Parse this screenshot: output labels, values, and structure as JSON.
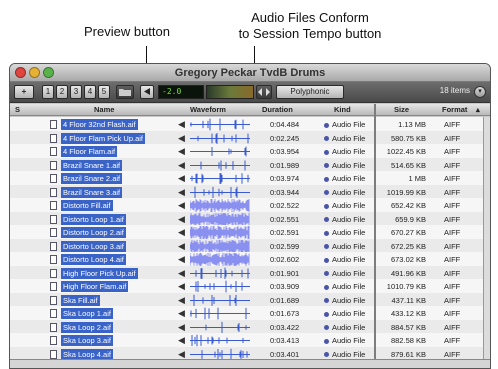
{
  "callouts": {
    "preview": "Preview button",
    "conform_line1": "Audio Files Conform",
    "conform_line2": "to Session Tempo button"
  },
  "window": {
    "title": "Gregory Peckar TvdB Drums"
  },
  "toolbar": {
    "add_label": "+",
    "nums": [
      "1",
      "2",
      "3",
      "4",
      "5"
    ],
    "folder_icon": "folder-icon",
    "preview_icon": "play-triangle-icon",
    "level_value": "-2.0",
    "conform_icon": "conform-tempo-icon",
    "polyphonic_label": "Polyphonic",
    "item_count": "18 items",
    "options_icon": "options-circle-icon"
  },
  "columns": {
    "s": "S",
    "name": "Name",
    "waveform": "Waveform",
    "duration": "Duration",
    "kind": "Kind",
    "size": "Size",
    "format": "Format"
  },
  "colors": {
    "selection": "#3a63c8",
    "waveform_simple": "#3a5bd0",
    "waveform_dense": "#8a90f0",
    "kind_dot": "#4a55a8"
  },
  "rows": [
    {
      "name": "4 Floor 32nd Flash.aif",
      "duration": "0:04.484",
      "kind": "Audio File",
      "size": "1.13 MB",
      "format": "AIFF",
      "dense": false
    },
    {
      "name": "4 Floor Flam Pick Up.aif",
      "duration": "0:02.245",
      "kind": "Audio File",
      "size": "580.75 KB",
      "format": "AIFF",
      "dense": false
    },
    {
      "name": "4 Floor Flam.aif",
      "duration": "0:03.954",
      "kind": "Audio File",
      "size": "1022.45 KB",
      "format": "AIFF",
      "dense": false
    },
    {
      "name": "Brazil Snare 1.aif",
      "duration": "0:01.989",
      "kind": "Audio File",
      "size": "514.65 KB",
      "format": "AIFF",
      "dense": false
    },
    {
      "name": "Brazil Snare 2.aif",
      "duration": "0:03.974",
      "kind": "Audio File",
      "size": "1 MB",
      "format": "AIFF",
      "dense": false
    },
    {
      "name": "Brazil Snare 3.aif",
      "duration": "0:03.944",
      "kind": "Audio File",
      "size": "1019.99 KB",
      "format": "AIFF",
      "dense": false
    },
    {
      "name": "Distorto Fill.aif",
      "duration": "0:02.522",
      "kind": "Audio File",
      "size": "652.42 KB",
      "format": "AIFF",
      "dense": true
    },
    {
      "name": "Distorto Loop 1.aif",
      "duration": "0:02.551",
      "kind": "Audio File",
      "size": "659.9 KB",
      "format": "AIFF",
      "dense": true
    },
    {
      "name": "Distorto Loop 2.aif",
      "duration": "0:02.591",
      "kind": "Audio File",
      "size": "670.27 KB",
      "format": "AIFF",
      "dense": true
    },
    {
      "name": "Distorto Loop 3.aif",
      "duration": "0:02.599",
      "kind": "Audio File",
      "size": "672.25 KB",
      "format": "AIFF",
      "dense": true
    },
    {
      "name": "Distorto Loop 4.aif",
      "duration": "0:02.602",
      "kind": "Audio File",
      "size": "673.02 KB",
      "format": "AIFF",
      "dense": true
    },
    {
      "name": "High Floor Pick Up.aif",
      "duration": "0:01.901",
      "kind": "Audio File",
      "size": "491.96 KB",
      "format": "AIFF",
      "dense": false
    },
    {
      "name": "High Floor Flam.aif",
      "duration": "0:03.909",
      "kind": "Audio File",
      "size": "1010.79 KB",
      "format": "AIFF",
      "dense": false
    },
    {
      "name": "Ska Fill.aif",
      "duration": "0:01.689",
      "kind": "Audio File",
      "size": "437.11 KB",
      "format": "AIFF",
      "dense": false
    },
    {
      "name": "Ska Loop 1.aif",
      "duration": "0:01.673",
      "kind": "Audio File",
      "size": "433.12 KB",
      "format": "AIFF",
      "dense": false
    },
    {
      "name": "Ska Loop 2.aif",
      "duration": "0:03.422",
      "kind": "Audio File",
      "size": "884.57 KB",
      "format": "AIFF",
      "dense": false
    },
    {
      "name": "Ska Loop 3.aif",
      "duration": "0:03.413",
      "kind": "Audio File",
      "size": "882.58 KB",
      "format": "AIFF",
      "dense": false
    },
    {
      "name": "Ska Loop 4.aif",
      "duration": "0:03.401",
      "kind": "Audio File",
      "size": "879.61 KB",
      "format": "AIFF",
      "dense": false
    }
  ]
}
